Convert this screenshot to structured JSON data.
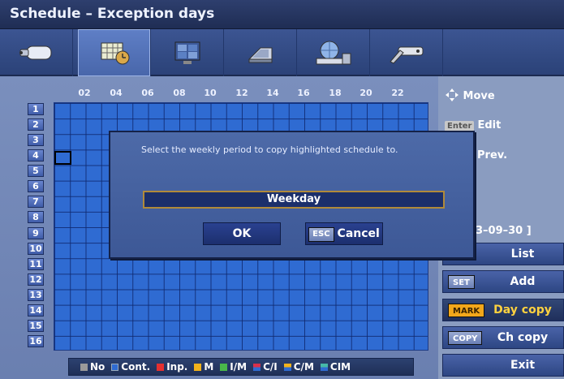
{
  "title": "Schedule – Exception days",
  "tabs": [
    {
      "icon": "camera-icon",
      "active": false
    },
    {
      "icon": "schedule-calendar-icon",
      "active": true
    },
    {
      "icon": "monitor-icon",
      "active": false
    },
    {
      "icon": "disk-icon",
      "active": false
    },
    {
      "icon": "network-icon",
      "active": false
    },
    {
      "icon": "tools-icon",
      "active": false
    }
  ],
  "hours": [
    "02",
    "04",
    "06",
    "08",
    "10",
    "12",
    "14",
    "16",
    "18",
    "20",
    "22"
  ],
  "rows": [
    "1",
    "2",
    "3",
    "4",
    "5",
    "6",
    "7",
    "8",
    "9",
    "10",
    "11",
    "12",
    "13",
    "14",
    "15",
    "16"
  ],
  "legend": [
    {
      "label": "No",
      "color": "#9a9a9a"
    },
    {
      "label": "Cont.",
      "color": "#2f6bd2"
    },
    {
      "label": "Inp.",
      "color": "#e53030"
    },
    {
      "label": "M",
      "color": "#f2b21b"
    },
    {
      "label": "I/M",
      "color": "#49b84a"
    },
    {
      "label": "C/I",
      "color": "#d9304a"
    },
    {
      "label": "C/M",
      "color": "#f2b21b"
    },
    {
      "label": "CIM",
      "color": "#46b8a8"
    }
  ],
  "help": {
    "move": "Move",
    "enter_key": "Enter",
    "edit": "Edit",
    "prev": "Prev.",
    "date_range": "3–09–30 ]"
  },
  "side_buttons": {
    "list": "List",
    "add_tag": "SET",
    "add": "Add",
    "daycopy_tag": "MARK",
    "daycopy": "Day copy",
    "chcopy_tag": "COPY",
    "chcopy": "Ch copy",
    "exit": "Exit"
  },
  "dialog": {
    "message": "Select the weekly period to copy highlighted schedule to.",
    "selected": "Weekday",
    "ok": "OK",
    "esc_key": "ESC",
    "cancel": "Cancel"
  },
  "colors": {
    "grid": "#2f6bd2",
    "accent": "#ffd23f"
  }
}
